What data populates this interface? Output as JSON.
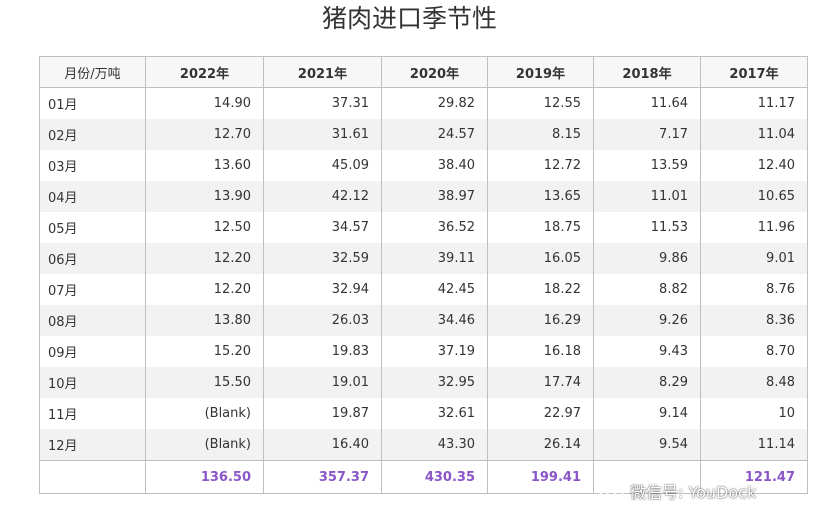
{
  "chart_data": {
    "type": "table",
    "title": "猪肉进口季节性",
    "corner_label": "月份/万吨",
    "columns": [
      "2022年",
      "2021年",
      "2020年",
      "2019年",
      "2018年",
      "2017年"
    ],
    "rows": [
      {
        "month": "01月",
        "values": [
          "14.90",
          "37.31",
          "29.82",
          "12.55",
          "11.64",
          "11.17"
        ]
      },
      {
        "month": "02月",
        "values": [
          "12.70",
          "31.61",
          "24.57",
          "8.15",
          "7.17",
          "11.04"
        ]
      },
      {
        "month": "03月",
        "values": [
          "13.60",
          "45.09",
          "38.40",
          "12.72",
          "13.59",
          "12.40"
        ]
      },
      {
        "month": "04月",
        "values": [
          "13.90",
          "42.12",
          "38.97",
          "13.65",
          "11.01",
          "10.65"
        ]
      },
      {
        "month": "05月",
        "values": [
          "12.50",
          "34.57",
          "36.52",
          "18.75",
          "11.53",
          "11.96"
        ]
      },
      {
        "month": "06月",
        "values": [
          "12.20",
          "32.59",
          "39.11",
          "16.05",
          "9.86",
          "9.01"
        ]
      },
      {
        "month": "07月",
        "values": [
          "12.20",
          "32.94",
          "42.45",
          "18.22",
          "8.82",
          "8.76"
        ]
      },
      {
        "month": "08月",
        "values": [
          "13.80",
          "26.03",
          "34.46",
          "16.29",
          "9.26",
          "8.36"
        ]
      },
      {
        "month": "09月",
        "values": [
          "15.20",
          "19.83",
          "37.19",
          "16.18",
          "9.43",
          "8.70"
        ]
      },
      {
        "month": "10月",
        "values": [
          "15.50",
          "19.01",
          "32.95",
          "17.74",
          "8.29",
          "8.48"
        ]
      },
      {
        "month": "11月",
        "values": [
          "(Blank)",
          "19.87",
          "32.61",
          "22.97",
          "9.14",
          "10"
        ]
      },
      {
        "month": "12月",
        "values": [
          "(Blank)",
          "16.40",
          "43.30",
          "26.14",
          "9.54",
          "11.14"
        ]
      }
    ],
    "totals_label": "",
    "totals": [
      "136.50",
      "357.37",
      "430.35",
      "199.41",
      "",
      "121.47"
    ],
    "total_color": "#8a56c8",
    "stripe_color": "#f2f2f2",
    "border_color": "#bfbfbf"
  },
  "watermark": {
    "text": "微信号: YouDock",
    "icon": "wechat-icon"
  }
}
